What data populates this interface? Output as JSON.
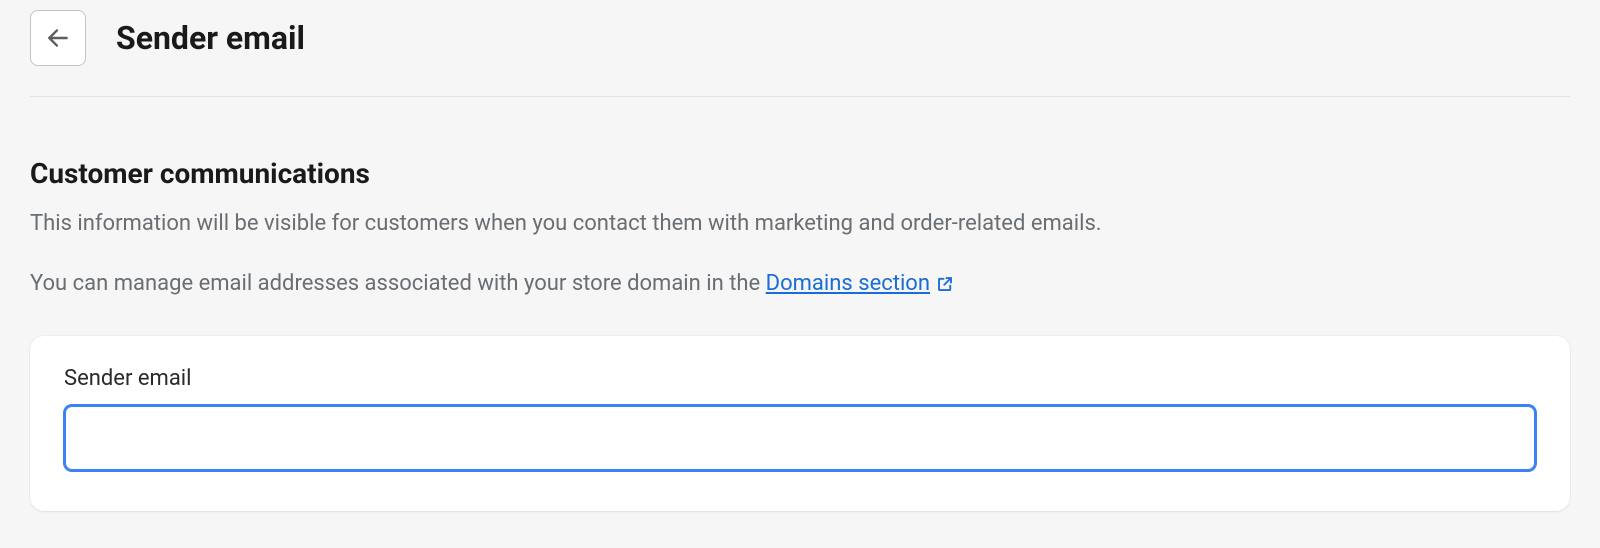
{
  "header": {
    "title": "Sender email"
  },
  "section": {
    "title": "Customer communications",
    "description": "This information will be visible for customers when you contact them with marketing and order-related emails.",
    "note_prefix": "You can manage email addresses associated with your store domain in the ",
    "link_label": "Domains section"
  },
  "form": {
    "sender_email_label": "Sender email",
    "sender_email_value": ""
  }
}
